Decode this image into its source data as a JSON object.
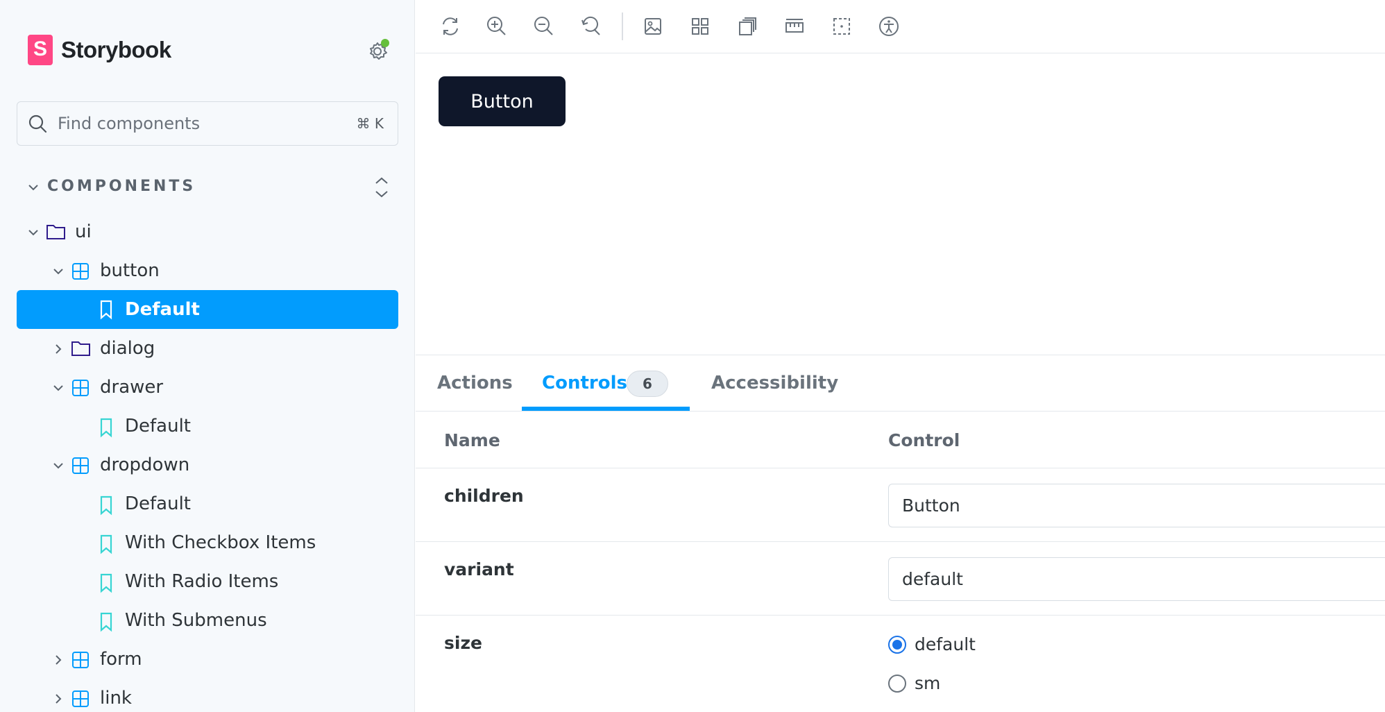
{
  "brand": {
    "logo_letter": "S",
    "name": "Storybook"
  },
  "search": {
    "placeholder": "Find components",
    "shortcut": "⌘ K"
  },
  "sidebar": {
    "section_title": "COMPONENTS",
    "tree": [
      {
        "label": "ui",
        "type": "folder",
        "expanded": true
      },
      {
        "label": "button",
        "type": "component",
        "expanded": true
      },
      {
        "label": "Default",
        "type": "story",
        "selected": true
      },
      {
        "label": "dialog",
        "type": "folder",
        "expanded": false
      },
      {
        "label": "drawer",
        "type": "component",
        "expanded": true
      },
      {
        "label": "Default",
        "type": "story"
      },
      {
        "label": "dropdown",
        "type": "component",
        "expanded": true
      },
      {
        "label": "Default",
        "type": "story"
      },
      {
        "label": "With Checkbox Items",
        "type": "story"
      },
      {
        "label": "With Radio Items",
        "type": "story"
      },
      {
        "label": "With Submenus",
        "type": "story"
      },
      {
        "label": "form",
        "type": "component",
        "expanded": false
      },
      {
        "label": "link",
        "type": "component",
        "expanded": false
      }
    ]
  },
  "toolbar": {
    "tools": [
      "reload-icon",
      "zoom-in-icon",
      "zoom-out-icon",
      "reset-zoom-icon",
      "background-icon",
      "grid-icon",
      "viewport-icon",
      "measure-icon",
      "outline-icon",
      "accessibility-icon"
    ]
  },
  "preview": {
    "button_label": "Button"
  },
  "addons": {
    "tabs": [
      {
        "label": "Actions",
        "active": false
      },
      {
        "label": "Controls",
        "active": true,
        "badge": "6"
      },
      {
        "label": "Accessibility",
        "active": false
      }
    ],
    "table": {
      "headers": {
        "name": "Name",
        "control": "Control"
      },
      "rows": [
        {
          "name": "children",
          "value": "Button"
        },
        {
          "name": "variant",
          "value": "default"
        },
        {
          "name": "size",
          "options": [
            {
              "label": "default",
              "checked": true
            },
            {
              "label": "sm",
              "checked": false
            }
          ]
        }
      ]
    }
  },
  "colors": {
    "accent": "#029cfd",
    "brand": "#ff4785",
    "primary_button": "#0f172a",
    "sidebar_bg": "#f6f9fc",
    "status_dot": "#66bf3c"
  }
}
